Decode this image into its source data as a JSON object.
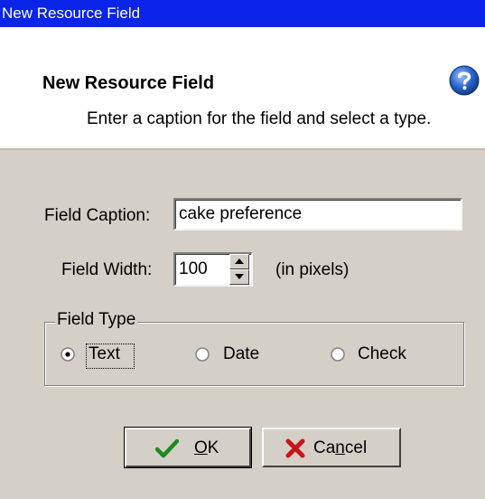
{
  "window": {
    "title": "New Resource Field"
  },
  "header": {
    "title": "New Resource Field",
    "subtitle": "Enter a caption for the field and select a type.",
    "help_icon": "help-question-icon"
  },
  "form": {
    "caption_label": "Field Caption:",
    "caption_value": "cake preference",
    "width_label": "Field Width:",
    "width_value": "100",
    "width_unit": "(in pixels)"
  },
  "field_type": {
    "legend": "Field Type",
    "options": [
      {
        "label": "Text",
        "selected": true
      },
      {
        "label": "Date",
        "selected": false
      },
      {
        "label": "Check",
        "selected": false
      }
    ]
  },
  "buttons": {
    "ok_prefix": "",
    "ok_mnemonic": "O",
    "ok_rest": "K",
    "cancel_prefix": "Ca",
    "cancel_mnemonic": "n",
    "cancel_rest": "cel"
  },
  "colors": {
    "titlebar": "#0a24e8",
    "dialog_bg": "#d4d0c8",
    "ok_check": "#1f8a1f",
    "cancel_x": "#c8141a",
    "help_blue": "#2a64c8"
  }
}
